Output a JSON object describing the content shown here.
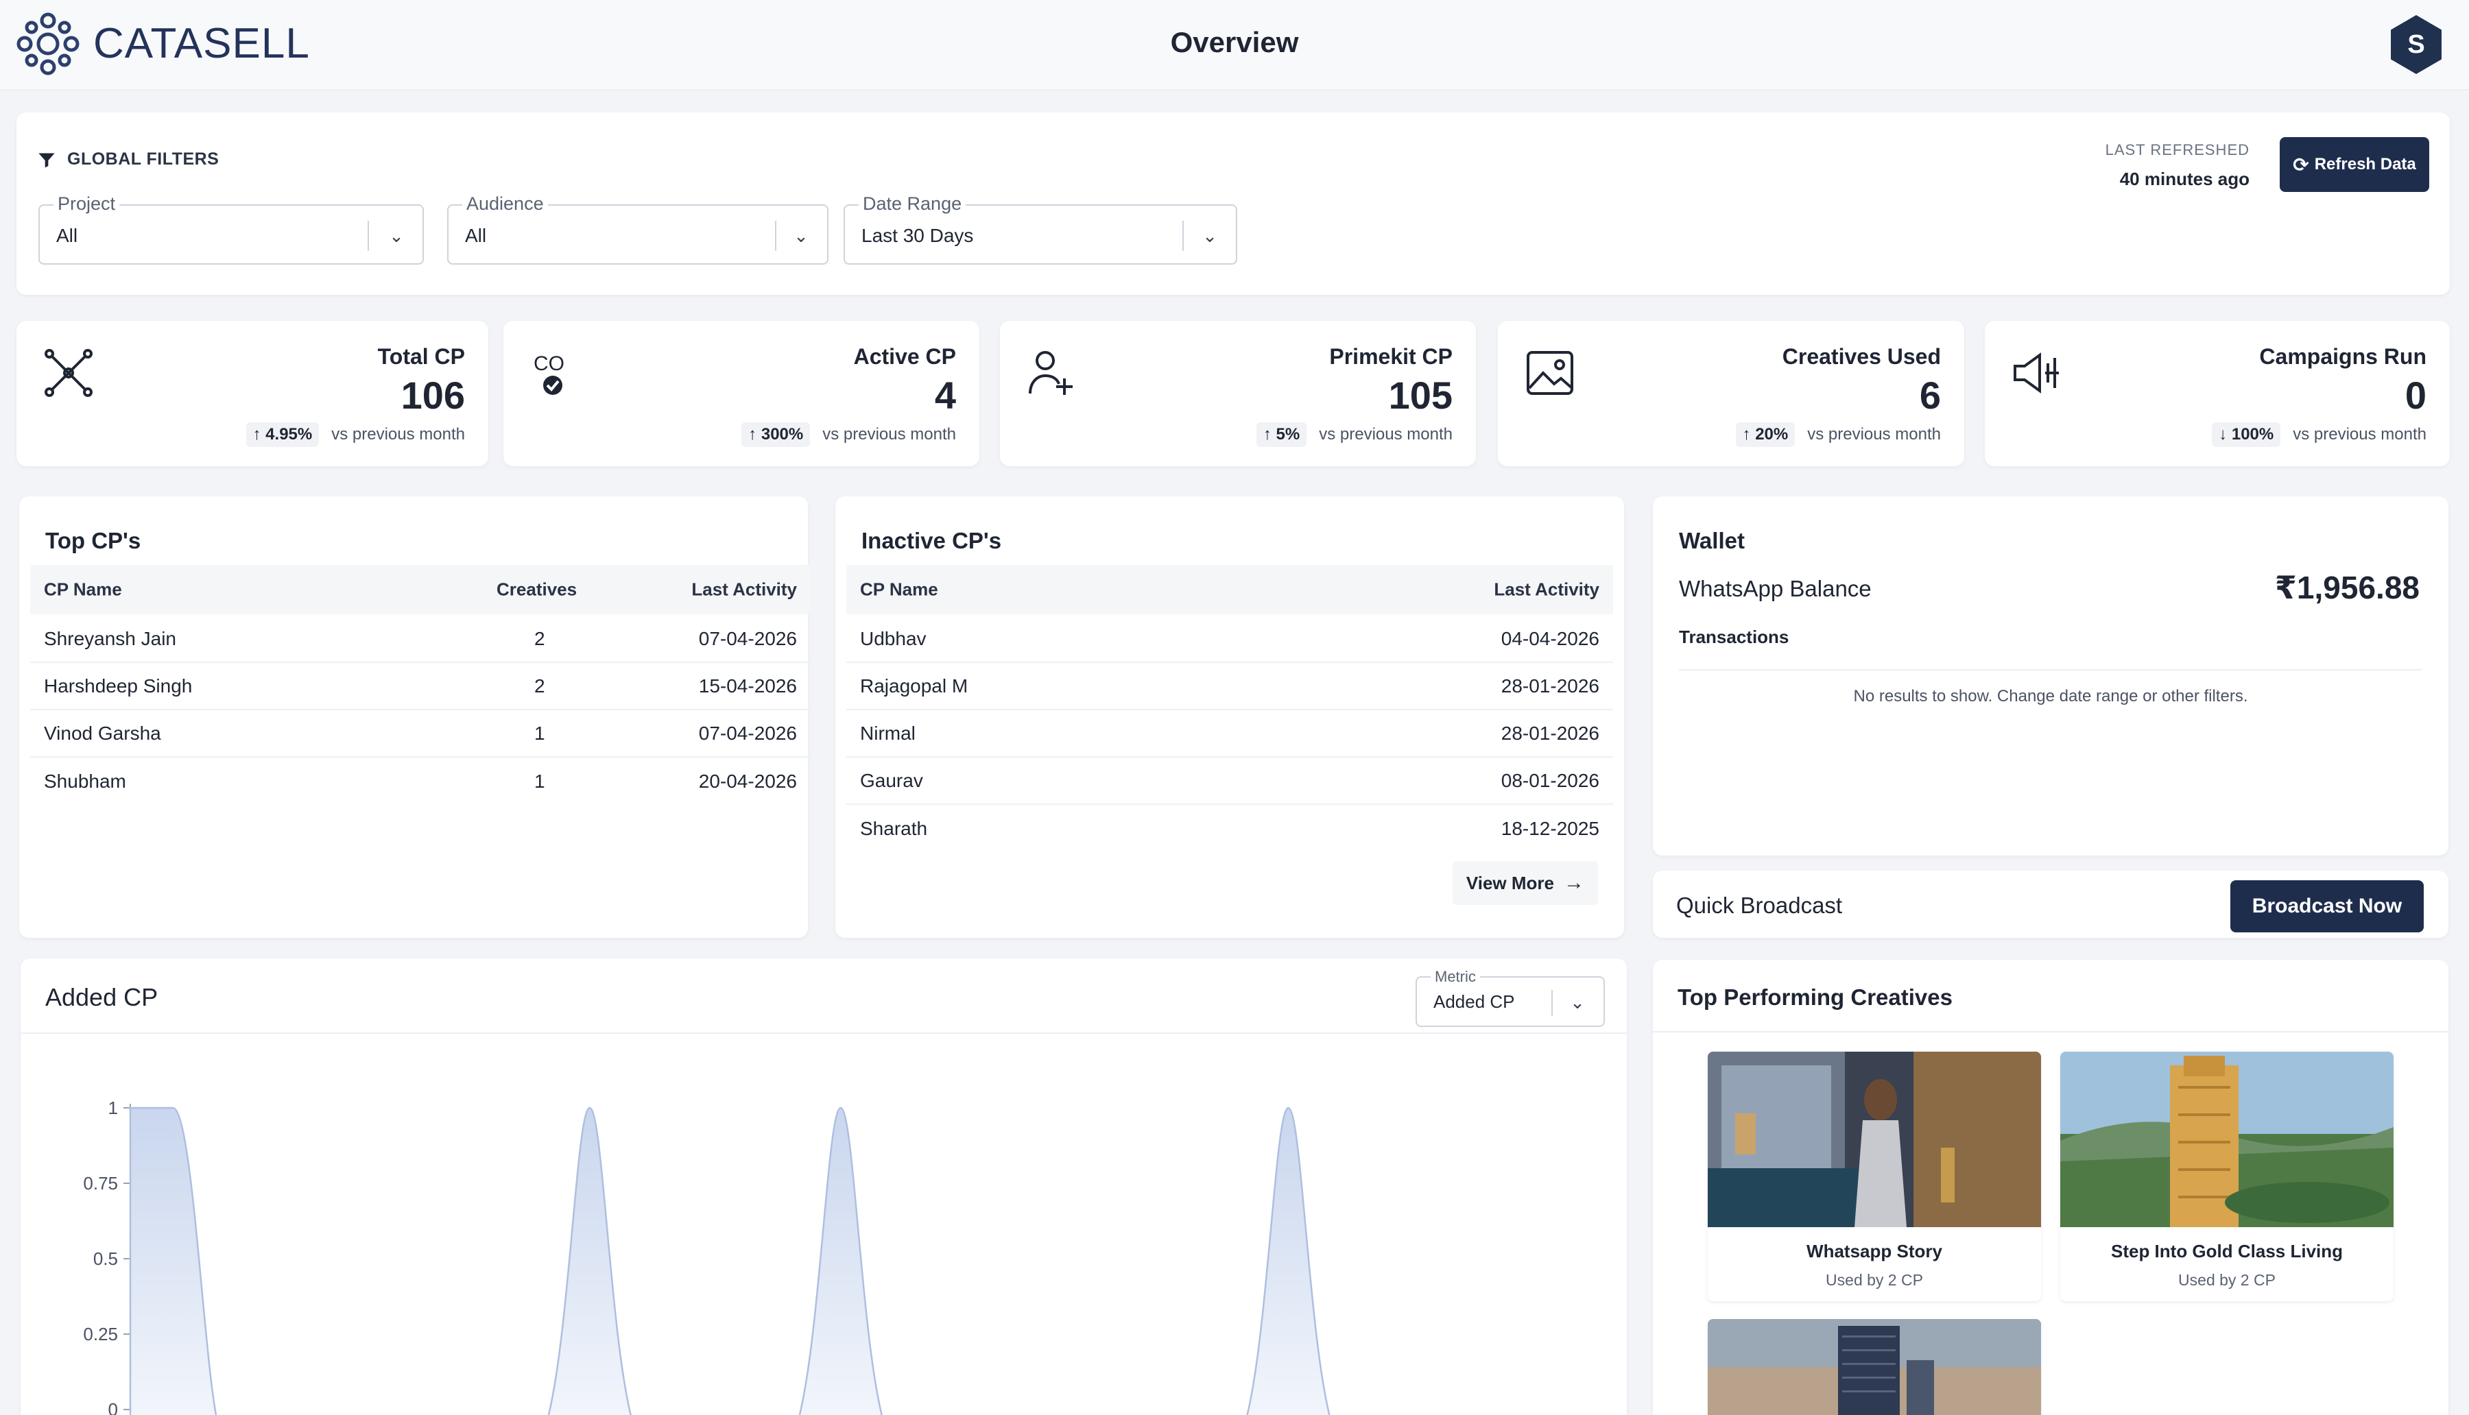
{
  "header": {
    "brand": "CATASELL",
    "title": "Overview",
    "avatar_letter": "S"
  },
  "filters": {
    "title": "GLOBAL FILTERS",
    "project": {
      "label": "Project",
      "value": "All"
    },
    "audience": {
      "label": "Audience",
      "value": "All"
    },
    "date_range": {
      "label": "Date Range",
      "value": "Last 30 Days"
    },
    "last_refreshed_label": "LAST REFRESHED",
    "last_refreshed_value": "40 minutes ago",
    "refresh_button": "Refresh Data"
  },
  "kpis": [
    {
      "label": "Total CP",
      "value": "106",
      "change": "4.95%",
      "direction": "up",
      "note": "vs previous month",
      "icon": "network-icon"
    },
    {
      "label": "Active CP",
      "value": "4",
      "change": "300%",
      "direction": "up",
      "note": "vs previous month",
      "icon": "active-user-check-icon"
    },
    {
      "label": "Primekit CP",
      "value": "105",
      "change": "5%",
      "direction": "up",
      "note": "vs previous month",
      "icon": "user-plus-icon"
    },
    {
      "label": "Creatives Used",
      "value": "6",
      "change": "20%",
      "direction": "up",
      "note": "vs previous month",
      "icon": "image-icon"
    },
    {
      "label": "Campaigns Run",
      "value": "0",
      "change": "100%",
      "direction": "down",
      "note": "vs previous month",
      "icon": "megaphone-icon"
    }
  ],
  "top_cps": {
    "title": "Top CP's",
    "columns": [
      "CP Name",
      "Creatives",
      "Last Activity"
    ],
    "rows": [
      [
        "Shreyansh Jain",
        "2",
        "07-04-2026"
      ],
      [
        "Harshdeep Singh",
        "2",
        "15-04-2026"
      ],
      [
        "Vinod Garsha",
        "1",
        "07-04-2026"
      ],
      [
        "Shubham",
        "1",
        "20-04-2026"
      ]
    ]
  },
  "inactive_cps": {
    "title": "Inactive CP's",
    "columns": [
      "CP Name",
      "Last Activity"
    ],
    "rows": [
      [
        "Udbhav",
        "04-04-2026"
      ],
      [
        "Rajagopal M",
        "28-01-2026"
      ],
      [
        "Nirmal",
        "28-01-2026"
      ],
      [
        "Gaurav",
        "08-01-2026"
      ],
      [
        "Sharath",
        "18-12-2025"
      ]
    ],
    "view_more": "View More"
  },
  "wallet": {
    "title": "Wallet",
    "balance_label": "WhatsApp Balance",
    "balance_value": "₹1,956.88",
    "transactions_label": "Transactions",
    "empty_text": "No results to show. Change date range or other filters."
  },
  "quick_broadcast": {
    "title": "Quick Broadcast",
    "button": "Broadcast Now"
  },
  "added_cp": {
    "title": "Added CP",
    "metric_label": "Metric",
    "metric_value": "Added CP"
  },
  "chart_data": {
    "type": "area",
    "title": "Added CP",
    "ylim": [
      0,
      1
    ],
    "y_ticks": [
      "1",
      "0.75",
      "0.5",
      "0.25",
      "0"
    ],
    "peaks": [
      {
        "x_frac": 0.0,
        "value": 1,
        "flat": true
      },
      {
        "x_frac": 0.313,
        "value": 1
      },
      {
        "x_frac": 0.484,
        "value": 1
      },
      {
        "x_frac": 0.789,
        "value": 1
      }
    ],
    "colors": {
      "stroke": "#aebfdf",
      "fill_top": "#c9d6ee",
      "fill_bottom": "#f4f7fc"
    }
  },
  "top_creatives": {
    "title": "Top Performing Creatives",
    "items": [
      {
        "title": "Whatsapp Story",
        "subtitle": "Used by 2 CP"
      },
      {
        "title": "Step Into Gold Class Living",
        "subtitle": "Used by 2 CP"
      },
      {
        "title": "",
        "subtitle": ""
      }
    ]
  }
}
